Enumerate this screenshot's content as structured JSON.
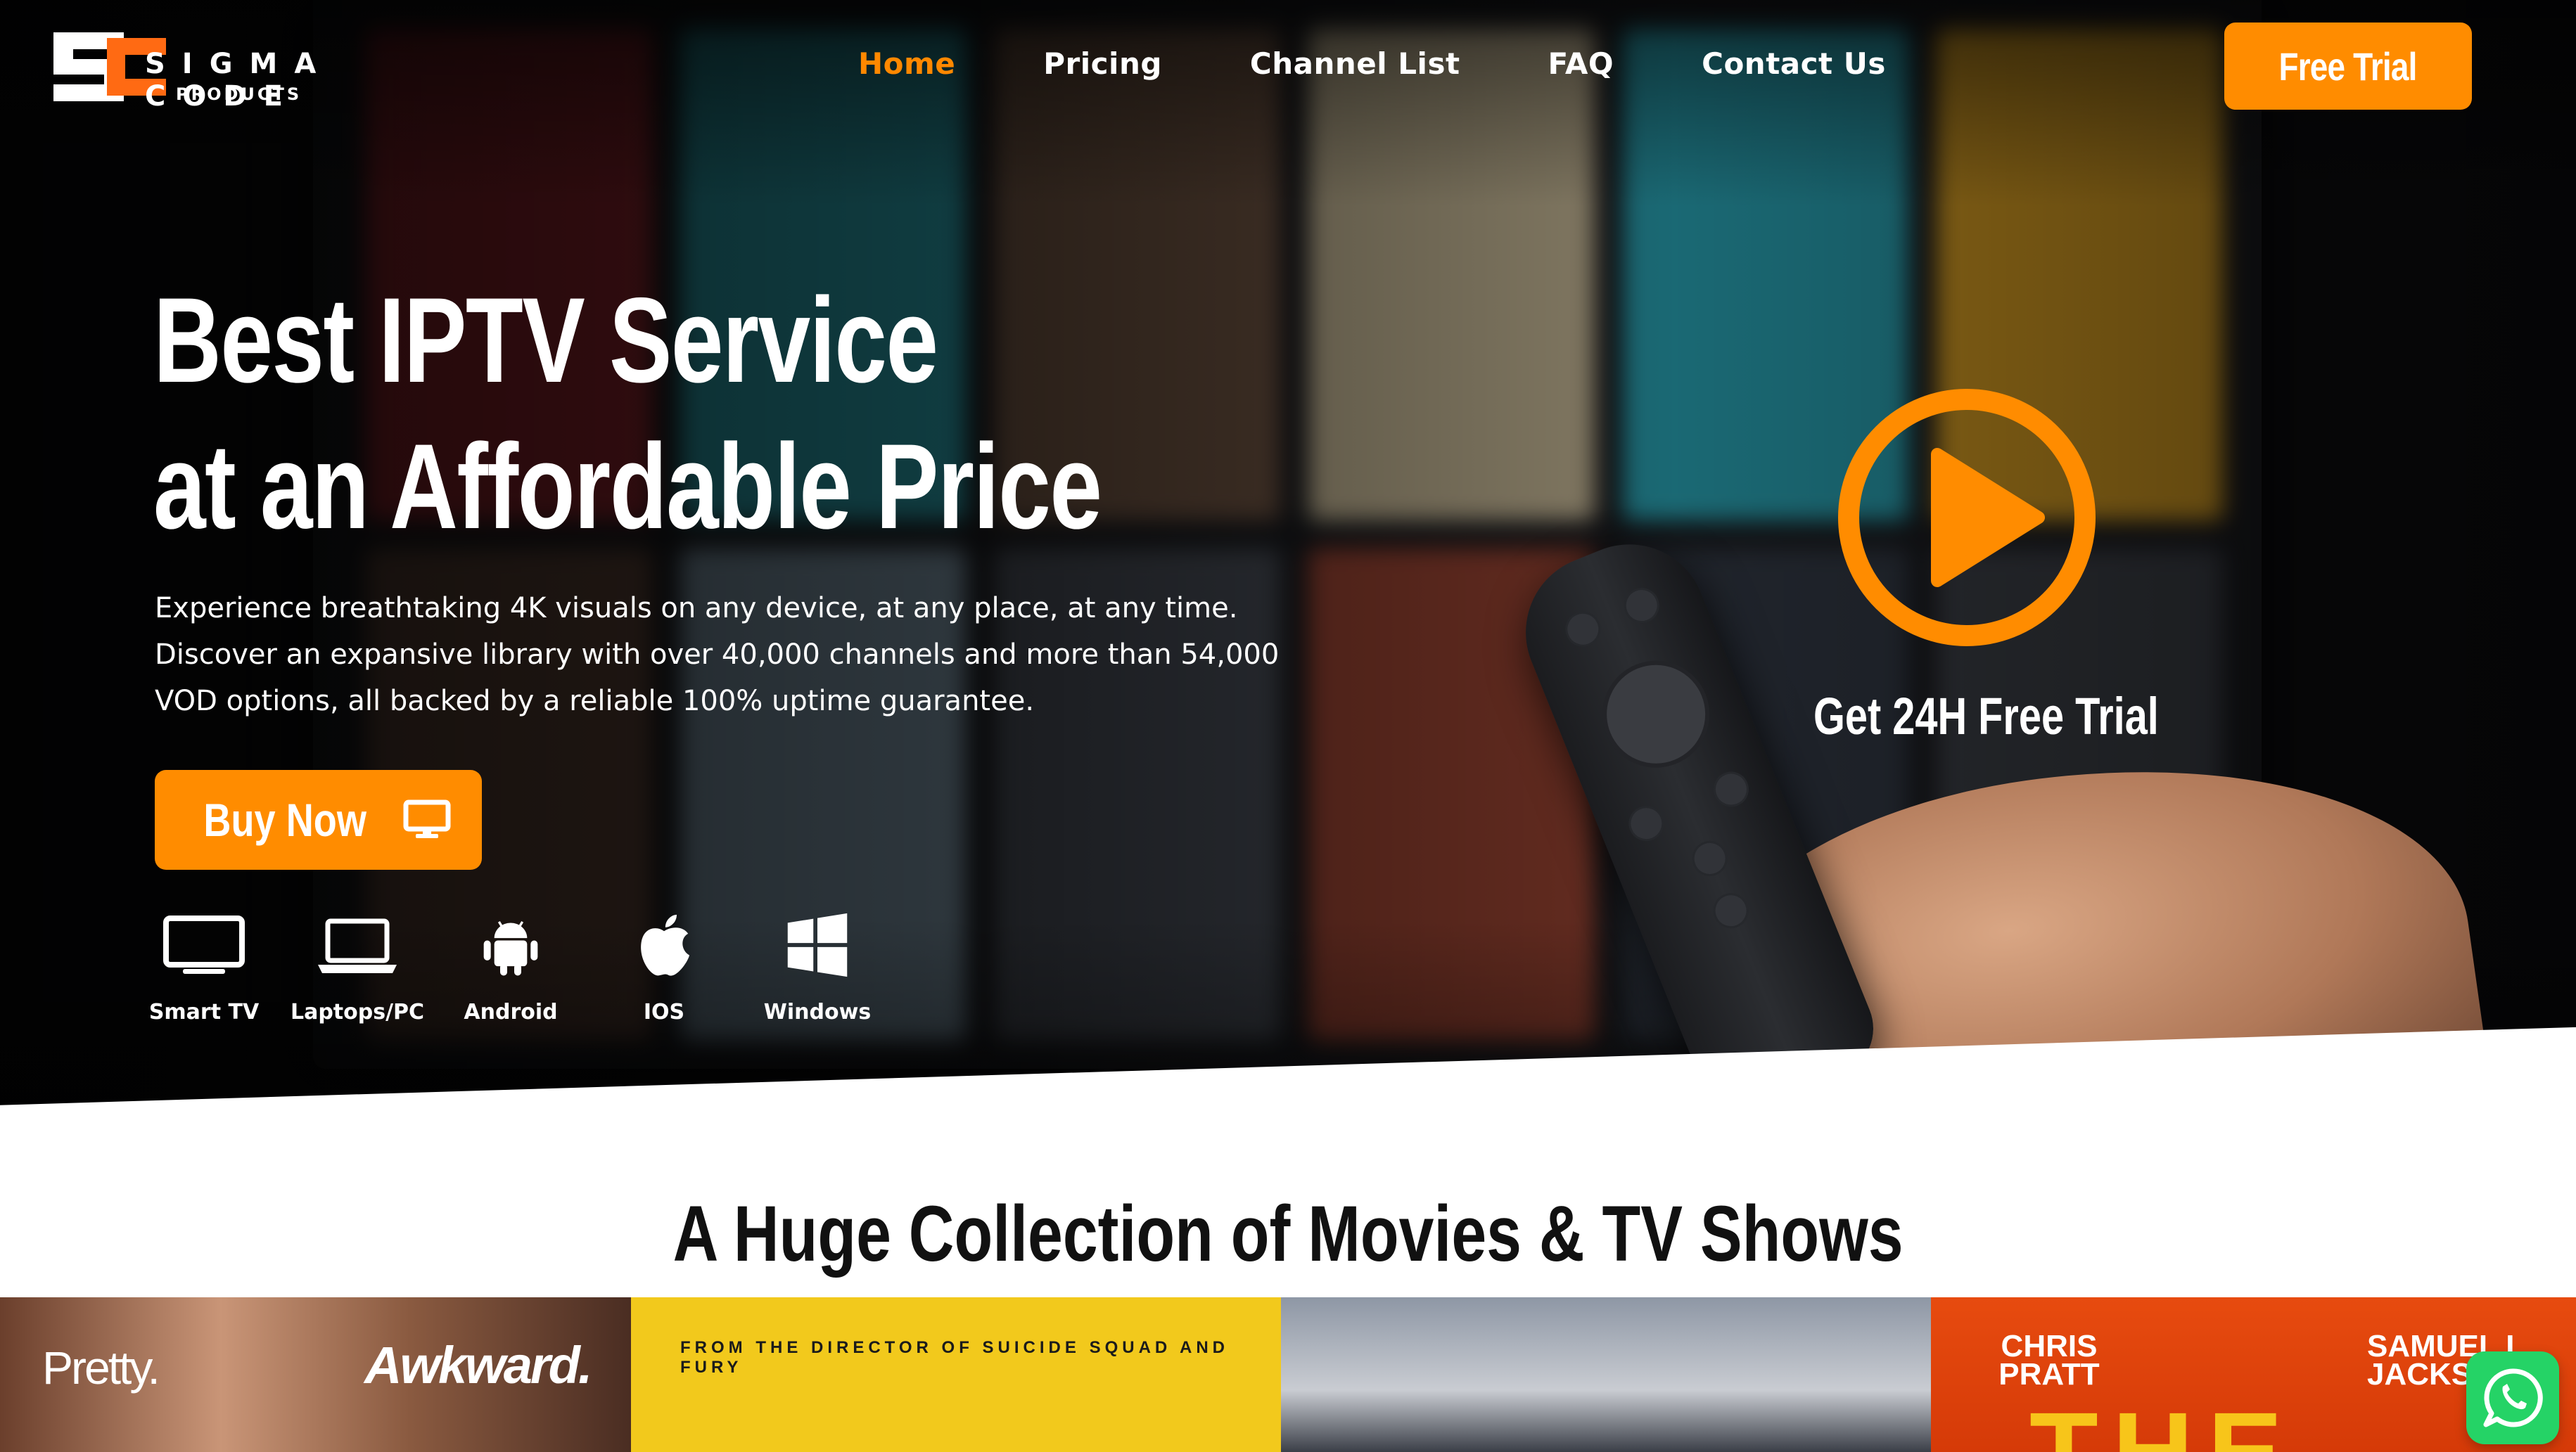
{
  "brand": {
    "name": "SIGMA CODE",
    "sub": "PRODUCTS",
    "accent": "#ff8c00"
  },
  "nav": {
    "items": [
      "Home",
      "Pricing",
      "Channel List",
      "FAQ",
      "Contact Us"
    ],
    "active": "Home"
  },
  "header": {
    "cta": "Free Trial"
  },
  "hero": {
    "title_line1": "Best IPTV Service",
    "title_line2": "at an Affordable Price",
    "description_line1": "Experience breathtaking 4K visuals on any device, at any place, at any time.",
    "description_line2": "Discover an expansive library with over 40,000 channels and more than 54,000",
    "description_line3": "VOD options, all backed by a reliable 100% uptime guarantee.",
    "buy_label": "Buy Now",
    "buy_icon": "monitor-icon",
    "trial_link": "Get 24H Free Trial",
    "play_icon": "play-icon"
  },
  "devices": [
    {
      "label": "Smart TV",
      "icon": "smart-tv-icon"
    },
    {
      "label": "Laptops/PC",
      "icon": "laptop-icon"
    },
    {
      "label": "Android",
      "icon": "android-icon"
    },
    {
      "label": "IOS",
      "icon": "apple-icon"
    },
    {
      "label": "Windows",
      "icon": "windows-icon"
    }
  ],
  "collection": {
    "title": "A Huge Collection of Movies & TV Shows",
    "posters": [
      {
        "text1": "Pretty.",
        "text2": "Awkward."
      },
      {
        "text1": "FROM THE DIRECTOR OF SUICIDE SQUAD AND FURY"
      },
      {},
      {
        "text1": "CHRIS PRATT",
        "text2": "SAMUEL L. JACKS",
        "text3": "THE"
      }
    ]
  },
  "floating": {
    "icon": "whatsapp-icon"
  }
}
